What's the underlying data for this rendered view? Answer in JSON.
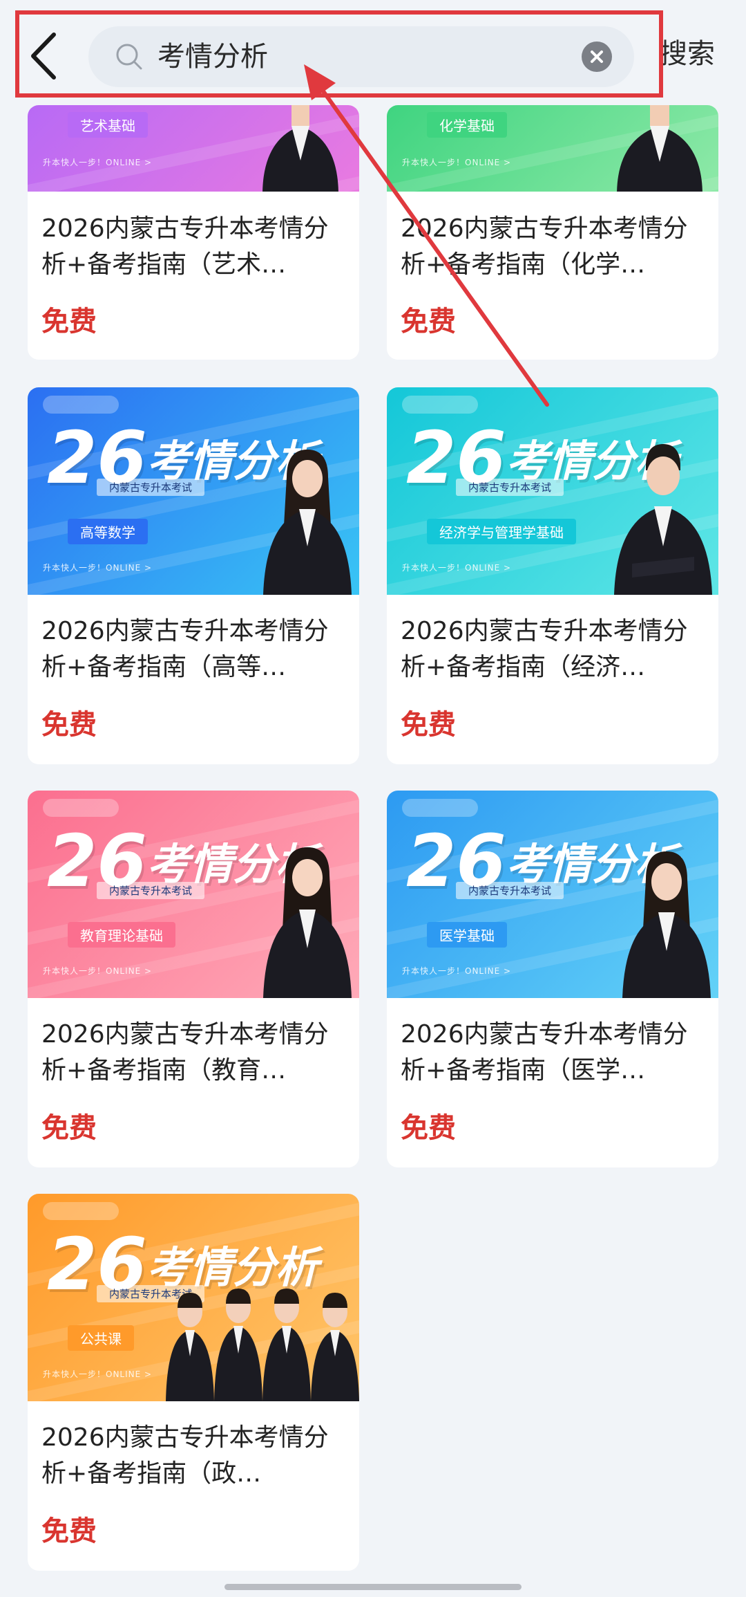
{
  "header": {
    "search_value": "考情分析",
    "search_button": "搜索"
  },
  "thumbnail": {
    "headline_num": "26",
    "headline_text": "考情分析",
    "region_tag": "内蒙古专升本考试",
    "tagline": "升本快人一步！ONLINE >"
  },
  "courses": [
    {
      "title": "2026内蒙古专升本考情分析+备考指南（艺术…",
      "price": "免费",
      "subject": "艺术基础",
      "theme_colors": [
        "#b86af5",
        "#e97ae0"
      ]
    },
    {
      "title": "2026内蒙古专升本考情分析+备考指南（化学…",
      "price": "免费",
      "subject": "化学基础",
      "theme_colors": [
        "#3fd480",
        "#8fe9a8"
      ]
    },
    {
      "title": "2026内蒙古专升本考情分析+备考指南（高等…",
      "price": "免费",
      "subject": "高等数学",
      "theme_colors": [
        "#2b6ff2",
        "#39c5f5"
      ]
    },
    {
      "title": "2026内蒙古专升本考情分析+备考指南（经济…",
      "price": "免费",
      "subject": "经济学与管理学基础",
      "theme_colors": [
        "#14c7d8",
        "#5fe6e6"
      ]
    },
    {
      "title": "2026内蒙古专升本考情分析+备考指南（教育…",
      "price": "免费",
      "subject": "教育理论基础",
      "theme_colors": [
        "#fb6f8f",
        "#ffaab8"
      ]
    },
    {
      "title": "2026内蒙古专升本考情分析+备考指南（医学…",
      "price": "免费",
      "subject": "医学基础",
      "theme_colors": [
        "#2d9af2",
        "#63d2f7"
      ]
    },
    {
      "title": "2026内蒙古专升本考情分析+备考指南（政…",
      "price": "免费",
      "subject": "公共课",
      "theme_colors": [
        "#ff9a2a",
        "#ffc56a"
      ]
    }
  ]
}
